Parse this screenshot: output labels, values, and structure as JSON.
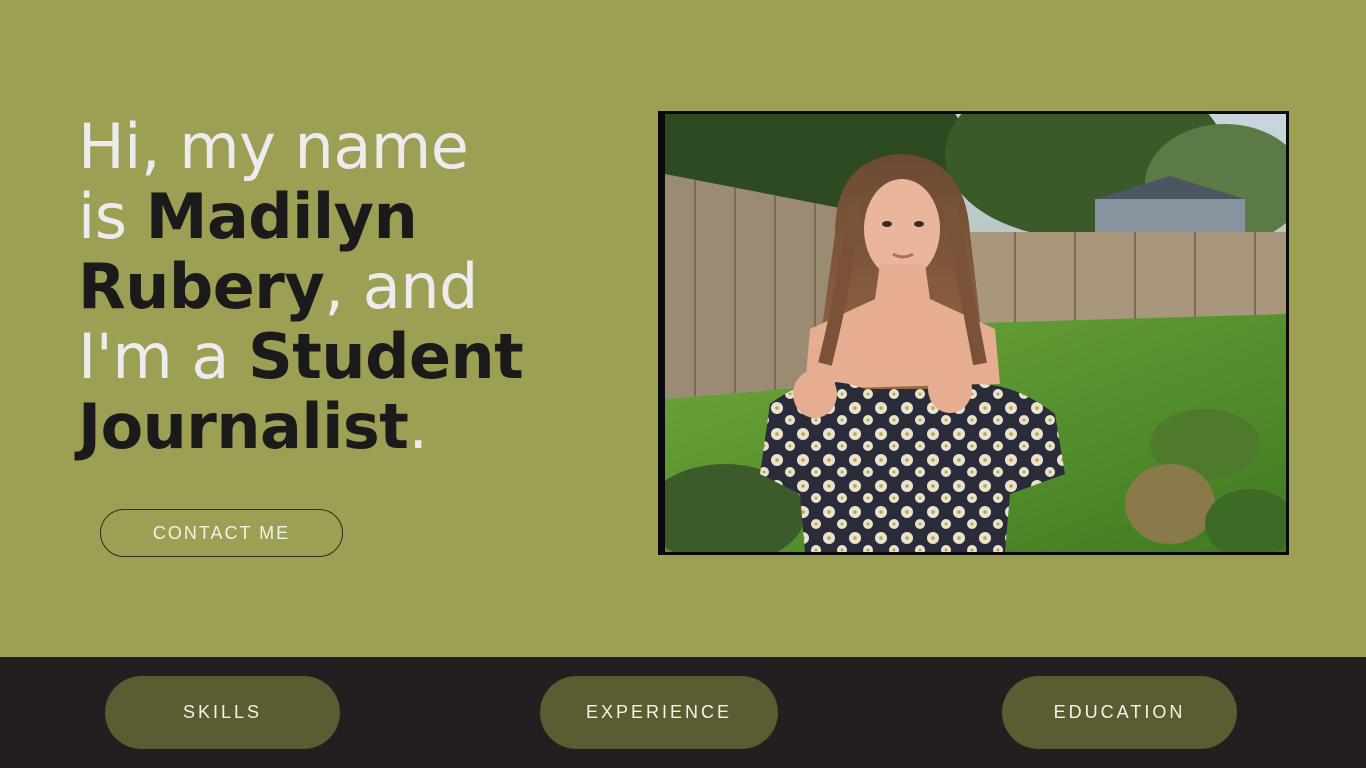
{
  "hero": {
    "headline": {
      "line1_light": "Hi, my name",
      "line2_light": "is ",
      "line2_dark": "Madilyn",
      "line3_dark": "Rubery",
      "line3_light": ", and",
      "line4_light": "I'm a ",
      "line4_dark": "Student",
      "line5_dark": "Journalist",
      "line5_light": "."
    },
    "contact_label": "CONTACT ME",
    "photo_icon": "portrait-photo"
  },
  "nav": {
    "skills_label": "SKILLS",
    "experience_label": "EXPERIENCE",
    "education_label": "EDUCATION"
  },
  "colors": {
    "page_background": "#9d9f54",
    "bottom_bar": "#231f20",
    "pill": "#5a5c31",
    "headline_light": "#ececec",
    "headline_dark": "#1a1a1a"
  }
}
